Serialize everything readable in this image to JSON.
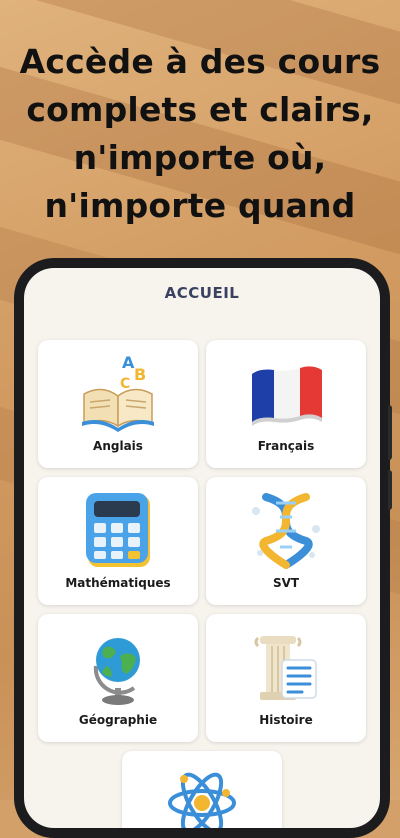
{
  "headline": {
    "line1": "Accède à des cours",
    "line2": "complets et clairs,",
    "line3": "n'importe où,",
    "line4": "n'importe quand"
  },
  "app": {
    "title": "ACCUEIL",
    "subjects": [
      {
        "label": "Anglais",
        "icon": "open-book-abc-icon"
      },
      {
        "label": "Français",
        "icon": "french-flag-icon"
      },
      {
        "label": "Mathématiques",
        "icon": "calculator-icon"
      },
      {
        "label": "SVT",
        "icon": "dna-helix-icon"
      },
      {
        "label": "Géographie",
        "icon": "globe-icon"
      },
      {
        "label": "Histoire",
        "icon": "column-scroll-icon"
      },
      {
        "label": "",
        "icon": "atom-icon"
      }
    ]
  },
  "colors": {
    "background": "#d4a06a",
    "screen": "#f7f4ee",
    "title": "#3b4160"
  }
}
